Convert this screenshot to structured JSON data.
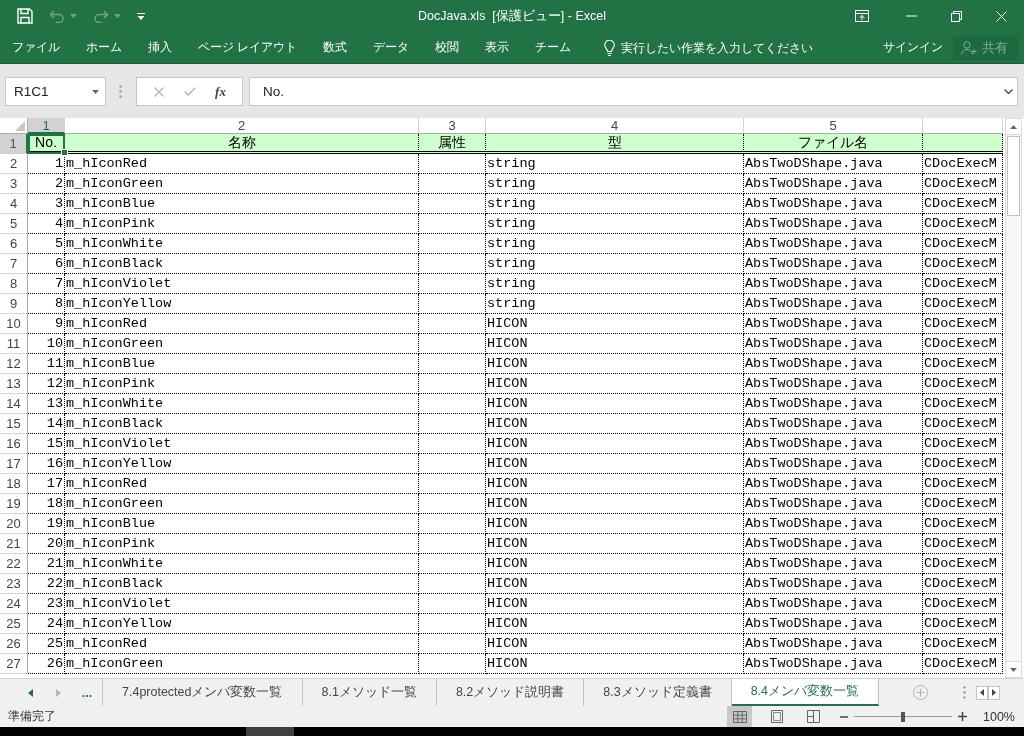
{
  "title_bar": {
    "quick_access": [
      {
        "kind": "save",
        "disabled": false
      },
      {
        "kind": "undo",
        "disabled": true
      },
      {
        "kind": "redo",
        "disabled": true
      },
      {
        "kind": "customize",
        "disabled": false
      }
    ],
    "title": "DocJava.xls  [保護ビュー] - Excel"
  },
  "ribbon": {
    "tabs": [
      {
        "label": "ファイル",
        "selected": false
      },
      {
        "label": "ホーム",
        "selected": false
      },
      {
        "label": "挿入",
        "selected": false
      },
      {
        "label": "ページ レイアウト",
        "selected": false
      },
      {
        "label": "数式",
        "selected": false
      },
      {
        "label": "データ",
        "selected": false
      },
      {
        "label": "校閲",
        "selected": false
      },
      {
        "label": "表示",
        "selected": false
      },
      {
        "label": "チーム",
        "selected": false
      }
    ],
    "tell_me": {
      "placeholder": "実行したい作業を入力してください"
    },
    "sign_in": "サインイン",
    "share": {
      "label": "共有",
      "disabled": true
    }
  },
  "formula_bar": {
    "name_box": "R1C1",
    "buttons": [
      {
        "kind": "cancel",
        "disabled": true
      },
      {
        "kind": "enter",
        "disabled": true
      },
      {
        "kind": "function",
        "label": "fx",
        "disabled": false
      }
    ],
    "formula": "No."
  },
  "sheet": {
    "columns": [
      {
        "label": "1",
        "selected": true
      },
      {
        "label": "2",
        "selected": false
      },
      {
        "label": "3",
        "selected": false
      },
      {
        "label": "4",
        "selected": false
      },
      {
        "label": "5",
        "selected": false
      }
    ],
    "header_row": {
      "row_number": "1",
      "selected": true,
      "cells": [
        "No.",
        "名称",
        "属性",
        "型",
        "ファイル名"
      ]
    },
    "rows": [
      {
        "row_number": "2",
        "selected": false,
        "no": "1",
        "name": "m_hIconRed",
        "type": "string",
        "file": "AbsTwoDShape.java",
        "column_6": "CDocExecM"
      },
      {
        "row_number": "3",
        "selected": false,
        "no": "2",
        "name": "m_hIconGreen",
        "type": "string",
        "file": "AbsTwoDShape.java",
        "column_6": "CDocExecM"
      },
      {
        "row_number": "4",
        "selected": false,
        "no": "3",
        "name": "m_hIconBlue",
        "type": "string",
        "file": "AbsTwoDShape.java",
        "column_6": "CDocExecM"
      },
      {
        "row_number": "5",
        "selected": false,
        "no": "4",
        "name": "m_hIconPink",
        "type": "string",
        "file": "AbsTwoDShape.java",
        "column_6": "CDocExecM"
      },
      {
        "row_number": "6",
        "selected": false,
        "no": "5",
        "name": "m_hIconWhite",
        "type": "string",
        "file": "AbsTwoDShape.java",
        "column_6": "CDocExecM"
      },
      {
        "row_number": "7",
        "selected": false,
        "no": "6",
        "name": "m_hIconBlack",
        "type": "string",
        "file": "AbsTwoDShape.java",
        "column_6": "CDocExecM"
      },
      {
        "row_number": "8",
        "selected": false,
        "no": "7",
        "name": "m_hIconViolet",
        "type": "string",
        "file": "AbsTwoDShape.java",
        "column_6": "CDocExecM"
      },
      {
        "row_number": "9",
        "selected": false,
        "no": "8",
        "name": "m_hIconYellow",
        "type": "string",
        "file": "AbsTwoDShape.java",
        "column_6": "CDocExecM"
      },
      {
        "row_number": "10",
        "selected": false,
        "no": "9",
        "name": "m_hIconRed",
        "type": "HICON",
        "file": "AbsTwoDShape.java",
        "column_6": "CDocExecM"
      },
      {
        "row_number": "11",
        "selected": false,
        "no": "10",
        "name": "m_hIconGreen",
        "type": "HICON",
        "file": "AbsTwoDShape.java",
        "column_6": "CDocExecM"
      },
      {
        "row_number": "12",
        "selected": false,
        "no": "11",
        "name": "m_hIconBlue",
        "type": "HICON",
        "file": "AbsTwoDShape.java",
        "column_6": "CDocExecM"
      },
      {
        "row_number": "13",
        "selected": false,
        "no": "12",
        "name": "m_hIconPink",
        "type": "HICON",
        "file": "AbsTwoDShape.java",
        "column_6": "CDocExecM"
      },
      {
        "row_number": "14",
        "selected": false,
        "no": "13",
        "name": "m_hIconWhite",
        "type": "HICON",
        "file": "AbsTwoDShape.java",
        "column_6": "CDocExecM"
      },
      {
        "row_number": "15",
        "selected": false,
        "no": "14",
        "name": "m_hIconBlack",
        "type": "HICON",
        "file": "AbsTwoDShape.java",
        "column_6": "CDocExecM"
      },
      {
        "row_number": "16",
        "selected": false,
        "no": "15",
        "name": "m_hIconViolet",
        "type": "HICON",
        "file": "AbsTwoDShape.java",
        "column_6": "CDocExecM"
      },
      {
        "row_number": "17",
        "selected": false,
        "no": "16",
        "name": "m_hIconYellow",
        "type": "HICON",
        "file": "AbsTwoDShape.java",
        "column_6": "CDocExecM"
      },
      {
        "row_number": "18",
        "selected": false,
        "no": "17",
        "name": "m_hIconRed",
        "type": "HICON",
        "file": "AbsTwoDShape.java",
        "column_6": "CDocExecM"
      },
      {
        "row_number": "19",
        "selected": false,
        "no": "18",
        "name": "m_hIconGreen",
        "type": "HICON",
        "file": "AbsTwoDShape.java",
        "column_6": "CDocExecM"
      },
      {
        "row_number": "20",
        "selected": false,
        "no": "19",
        "name": "m_hIconBlue",
        "type": "HICON",
        "file": "AbsTwoDShape.java",
        "column_6": "CDocExecM"
      },
      {
        "row_number": "21",
        "selected": false,
        "no": "20",
        "name": "m_hIconPink",
        "type": "HICON",
        "file": "AbsTwoDShape.java",
        "column_6": "CDocExecM"
      },
      {
        "row_number": "22",
        "selected": false,
        "no": "21",
        "name": "m_hIconWhite",
        "type": "HICON",
        "file": "AbsTwoDShape.java",
        "column_6": "CDocExecM"
      },
      {
        "row_number": "23",
        "selected": false,
        "no": "22",
        "name": "m_hIconBlack",
        "type": "HICON",
        "file": "AbsTwoDShape.java",
        "column_6": "CDocExecM"
      },
      {
        "row_number": "24",
        "selected": false,
        "no": "23",
        "name": "m_hIconViolet",
        "type": "HICON",
        "file": "AbsTwoDShape.java",
        "column_6": "CDocExecM"
      },
      {
        "row_number": "25",
        "selected": false,
        "no": "24",
        "name": "m_hIconYellow",
        "type": "HICON",
        "file": "AbsTwoDShape.java",
        "column_6": "CDocExecM"
      },
      {
        "row_number": "26",
        "selected": false,
        "no": "25",
        "name": "m_hIconRed",
        "type": "HICON",
        "file": "AbsTwoDShape.java",
        "column_6": "CDocExecM"
      },
      {
        "row_number": "27",
        "selected": false,
        "no": "26",
        "name": "m_hIconGreen",
        "type": "HICON",
        "file": "AbsTwoDShape.java",
        "column_6": "CDocExecM"
      }
    ]
  },
  "sheet_tabs": {
    "navigation": [
      {
        "kind": "previous",
        "disabled": false
      },
      {
        "kind": "next",
        "disabled": true
      }
    ],
    "more": "...",
    "tabs": [
      {
        "label": "7.4protectedメンバ変数一覧",
        "selected": false
      },
      {
        "label": "8.1メソッド一覧",
        "selected": false
      },
      {
        "label": "8.2メソッド説明書",
        "selected": false
      },
      {
        "label": "8.3メソッド定義書",
        "selected": false
      },
      {
        "label": "8.4メンバ変数一覧",
        "selected": true
      }
    ]
  },
  "status_bar": {
    "status": "準備完了",
    "views": [
      {
        "kind": "normal",
        "selected": true
      },
      {
        "kind": "page_layout",
        "selected": false
      },
      {
        "kind": "page_break",
        "selected": false
      }
    ],
    "zoom": {
      "level": 0.5,
      "reading": "100%"
    }
  }
}
